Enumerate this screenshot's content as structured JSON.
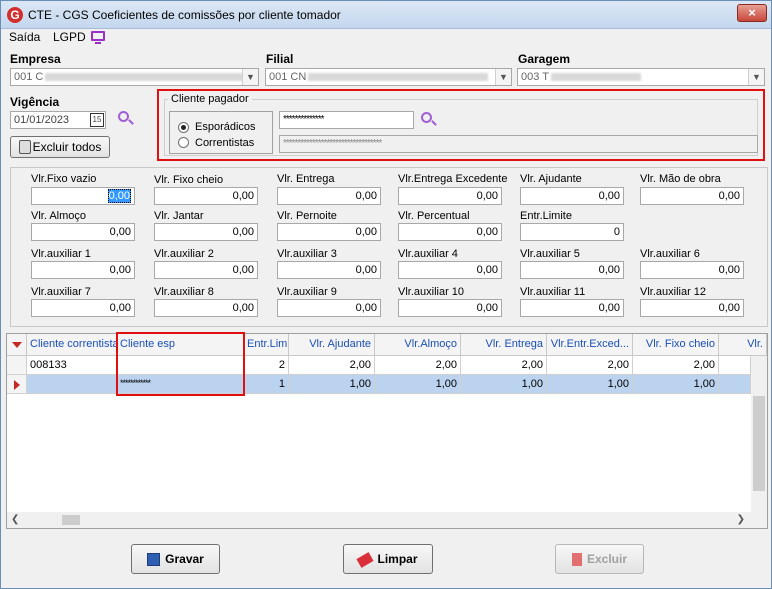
{
  "window": {
    "title": "CTE - CGS Coeficientes de comissões por cliente tomador",
    "close_glyph": "×",
    "app_icon_glyph": "G"
  },
  "menu": {
    "saida": "Saída",
    "lgpd": "LGPD",
    "monitor_icon": "monitor-icon"
  },
  "empresa": {
    "label": "Empresa",
    "value": "001 C"
  },
  "filial": {
    "label": "Filial",
    "value": "001 CN"
  },
  "garagem": {
    "label": "Garagem",
    "value": "003 T"
  },
  "vigencia": {
    "label": "Vigência",
    "value": "01/01/2023",
    "cal": "15"
  },
  "excluir_todos": "Excluir todos",
  "cliente_pagador": {
    "title": "Cliente pagador",
    "opt_esporadicos": "Esporádicos",
    "opt_correntistas": "Correntistas",
    "selected": "Esporádicos",
    "code_value": "**************",
    "name_value": "**********************************"
  },
  "fields": {
    "vlr_fixo_vazio": {
      "label": "Vlr.Fixo vazio",
      "value": "0,00"
    },
    "vlr_fixo_cheio": {
      "label": "Vlr. Fixo cheio",
      "value": "0,00"
    },
    "vlr_entrega": {
      "label": "Vlr. Entrega",
      "value": "0,00"
    },
    "vlr_entrega_excedente": {
      "label": "Vlr.Entrega Excedente",
      "value": "0,00"
    },
    "vlr_ajudante": {
      "label": "Vlr. Ajudante",
      "value": "0,00"
    },
    "vlr_mao_obra": {
      "label": "Vlr. Mão de obra",
      "value": "0,00"
    },
    "vlr_almoco": {
      "label": "Vlr. Almoço",
      "value": "0,00"
    },
    "vlr_jantar": {
      "label": "Vlr. Jantar",
      "value": "0,00"
    },
    "vlr_pernoite": {
      "label": "Vlr. Pernoite",
      "value": "0,00"
    },
    "vlr_percentual": {
      "label": "Vlr. Percentual",
      "value": "0,00"
    },
    "entr_limite": {
      "label": "Entr.Limite",
      "value": "0"
    },
    "aux1": {
      "label": "Vlr.auxiliar 1",
      "value": "0,00"
    },
    "aux2": {
      "label": "Vlr.auxiliar 2",
      "value": "0,00"
    },
    "aux3": {
      "label": "Vlr.auxiliar 3",
      "value": "0,00"
    },
    "aux4": {
      "label": "Vlr.auxiliar 4",
      "value": "0,00"
    },
    "aux5": {
      "label": "Vlr.auxiliar 5",
      "value": "0,00"
    },
    "aux6": {
      "label": "Vlr.auxiliar 6",
      "value": "0,00"
    },
    "aux7": {
      "label": "Vlr.auxiliar 7",
      "value": "0,00"
    },
    "aux8": {
      "label": "Vlr.auxiliar 8",
      "value": "0,00"
    },
    "aux9": {
      "label": "Vlr.auxiliar 9",
      "value": "0,00"
    },
    "aux10": {
      "label": "Vlr.auxiliar 10",
      "value": "0,00"
    },
    "aux11": {
      "label": "Vlr.auxiliar 11",
      "value": "0,00"
    },
    "aux12": {
      "label": "Vlr.auxiliar 12",
      "value": "0,00"
    }
  },
  "grid": {
    "columns": [
      "Cliente correntista",
      "Cliente esp",
      "Entr.Lim",
      "Vlr. Ajudante",
      "Vlr.Almoço",
      "Vlr. Entrega",
      "Vlr.Entr.Exced...",
      "Vlr. Fixo cheio",
      "Vlr."
    ],
    "rows": [
      [
        "008133",
        "",
        "2",
        "2,00",
        "2,00",
        "2,00",
        "2,00",
        "2,00",
        ""
      ],
      [
        "",
        "************",
        "1",
        "1,00",
        "1,00",
        "1,00",
        "1,00",
        "1,00",
        ""
      ]
    ],
    "selected_row": 1
  },
  "buttons": {
    "gravar": "Gravar",
    "limpar": "Limpar",
    "excluir": "Excluir"
  },
  "colors": {
    "highlight": "#e01010",
    "header_text": "#1a4fb5",
    "selection": "#bcd3f0"
  }
}
